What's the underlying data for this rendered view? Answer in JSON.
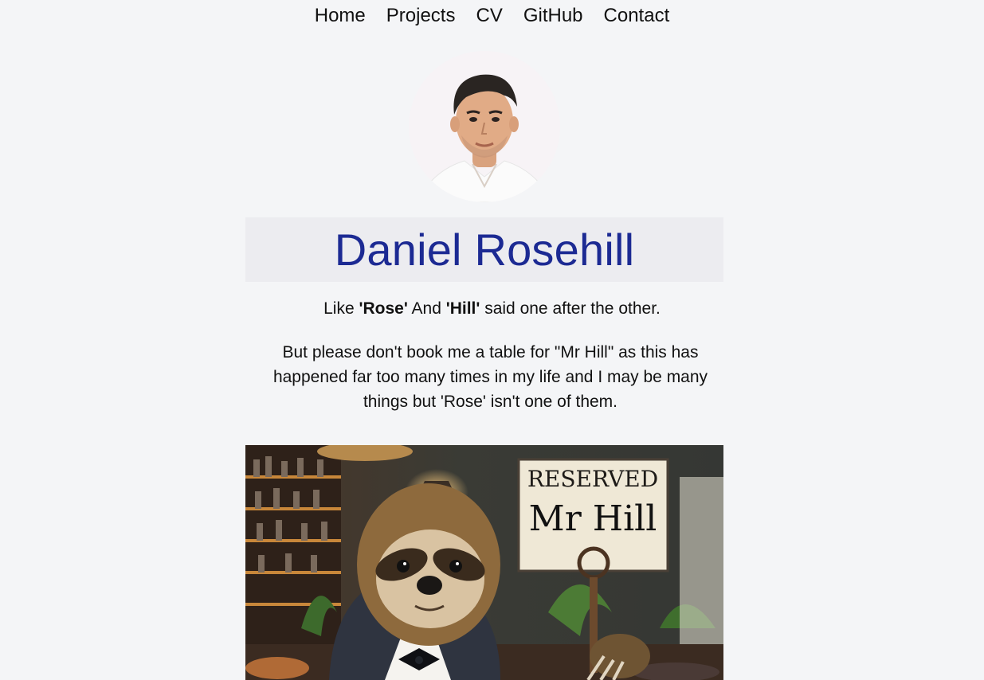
{
  "nav": {
    "items": [
      {
        "label": "Home"
      },
      {
        "label": "Projects"
      },
      {
        "label": "CV"
      },
      {
        "label": "GitHub"
      },
      {
        "label": "Contact"
      }
    ]
  },
  "profile": {
    "name": "Daniel Rosehill"
  },
  "tagline": {
    "prefix": "Like ",
    "rose": "'Rose'",
    "middle": " And ",
    "hill": "'Hill'",
    "suffix": " said one after the other."
  },
  "paragraph": {
    "text": "But please don't book me a table for \"Mr Hill\" as this has happened far too many times in my life and I may be many things but 'Rose' isn't one of them."
  },
  "hero_image": {
    "sign_line1": "RESERVED",
    "sign_line2": "Mr Hill"
  },
  "colors": {
    "background": "#f4f5f7",
    "name_color": "#1c2a93",
    "name_box": "#ececf0"
  }
}
